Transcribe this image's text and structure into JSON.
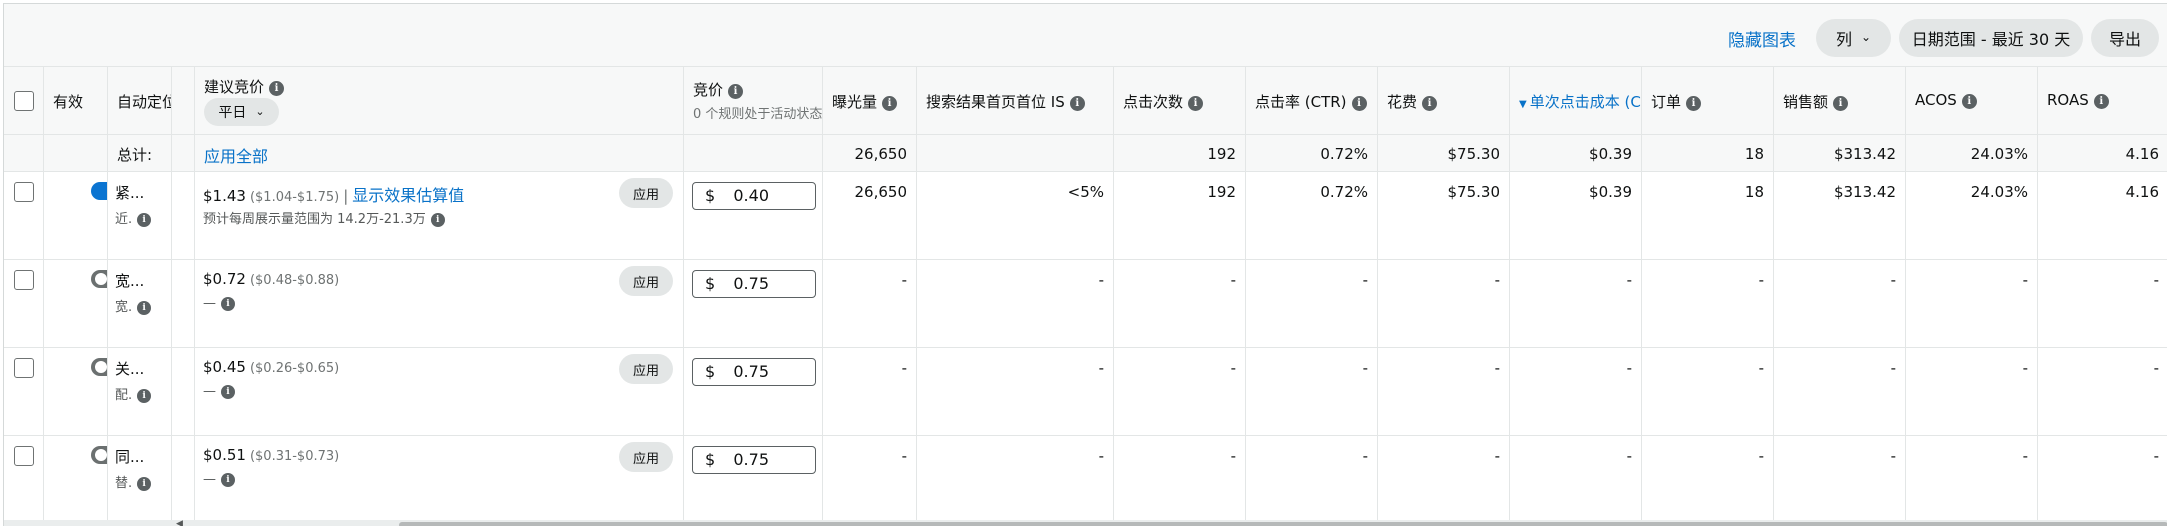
{
  "toolbar": {
    "hide_chart": "隐藏图表",
    "columns": "列",
    "date_range": "日期范围 - 最近 30 天",
    "export": "导出"
  },
  "headers": {
    "active": "有效",
    "targeting": "自动定位",
    "suggested_bid": "建议竞价",
    "bid_mode": "平日",
    "bid": "竞价",
    "bid_rules": "0 个规则处于活动状态",
    "impressions": "曝光量",
    "top_of_search_is": "搜索结果首页首位 IS",
    "clicks": "点击次数",
    "ctr": "点击率 (CTR)",
    "spend": "花费",
    "cpc": "单次点击成本 (CPC)",
    "orders": "订单",
    "sales": "销售额",
    "acos": "ACOS",
    "roas": "ROAS"
  },
  "totals": {
    "label": "总计:",
    "apply_all": "应用全部",
    "impressions": "26,650",
    "top_of_search_is": "",
    "clicks": "192",
    "ctr": "0.72%",
    "spend": "$75.30",
    "cpc": "$0.39",
    "orders": "18",
    "sales": "$313.42",
    "acos": "24.03%",
    "roas": "4.16"
  },
  "apply_label": "应用",
  "currency_symbol": "$",
  "rows": [
    {
      "enabled": true,
      "targeting_name": "紧...",
      "targeting_sub": "近.",
      "suggested_bid": "$1.43",
      "suggested_range": "($1.04-$1.75)",
      "divider": "|",
      "estimate_link": "显示效果估算值",
      "weekly_estimate": "预计每周展示量范围为 14.2万-21.3万",
      "bid": "0.40",
      "impressions": "26,650",
      "top_of_search_is": "<5%",
      "clicks": "192",
      "ctr": "0.72%",
      "spend": "$75.30",
      "cpc": "$0.39",
      "orders": "18",
      "sales": "$313.42",
      "acos": "24.03%",
      "roas": "4.16"
    },
    {
      "enabled": false,
      "targeting_name": "宽...",
      "targeting_sub": "宽.",
      "suggested_bid": "$0.72",
      "suggested_range": "($0.48-$0.88)",
      "weekly_estimate": "—",
      "bid": "0.75",
      "impressions": "-",
      "top_of_search_is": "-",
      "clicks": "-",
      "ctr": "-",
      "spend": "-",
      "cpc": "-",
      "orders": "-",
      "sales": "-",
      "acos": "-",
      "roas": "-"
    },
    {
      "enabled": false,
      "targeting_name": "关...",
      "targeting_sub": "配.",
      "suggested_bid": "$0.45",
      "suggested_range": "($0.26-$0.65)",
      "weekly_estimate": "—",
      "bid": "0.75",
      "impressions": "-",
      "top_of_search_is": "-",
      "clicks": "-",
      "ctr": "-",
      "spend": "-",
      "cpc": "-",
      "orders": "-",
      "sales": "-",
      "acos": "-",
      "roas": "-"
    },
    {
      "enabled": false,
      "targeting_name": "同...",
      "targeting_sub": "替.",
      "suggested_bid": "$0.51",
      "suggested_range": "($0.31-$0.73)",
      "weekly_estimate": "—",
      "bid": "0.75",
      "impressions": "-",
      "top_of_search_is": "-",
      "clicks": "-",
      "ctr": "-",
      "spend": "-",
      "cpc": "-",
      "orders": "-",
      "sales": "-",
      "acos": "-",
      "roas": "-"
    }
  ]
}
